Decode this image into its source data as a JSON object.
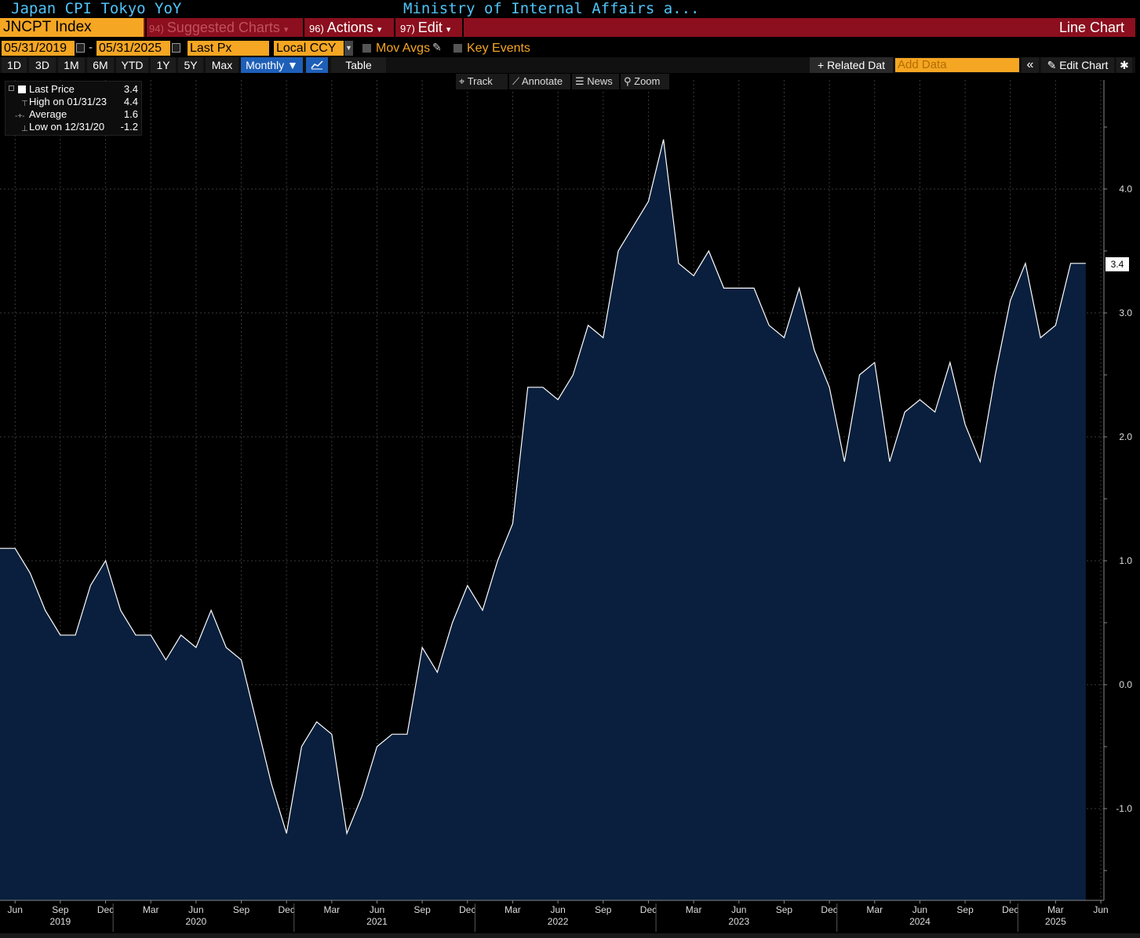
{
  "header": {
    "title_left": "Japan CPI Tokyo YoY",
    "title_right": "Ministry of Internal Affairs a..."
  },
  "command_bar": {
    "ticker": "JNCPT Index",
    "suggested_num": "94)",
    "suggested_label": "Suggested Charts",
    "actions_num": "96)",
    "actions_label": "Actions",
    "edit_num": "97)",
    "edit_label": "Edit",
    "chart_type": "Line Chart",
    "dropdown_glyph": "▾"
  },
  "range_bar": {
    "start_date": "05/31/2019",
    "end_date": "05/31/2025",
    "date_separator": "-",
    "field": "Last Px",
    "currency": "Local CCY",
    "mov_avgs": "Mov Avgs",
    "key_events": "Key Events"
  },
  "period_bar": {
    "buttons": [
      "1D",
      "3D",
      "1M",
      "6M",
      "YTD",
      "1Y",
      "5Y",
      "Max"
    ],
    "frequency": "Monthly ▼",
    "table": "Table",
    "related": "+ Related Dat",
    "add_data_placeholder": "Add Data",
    "collapse": "«",
    "edit_chart": "Edit Chart",
    "settings": "✱"
  },
  "tools": {
    "track": "Track",
    "annotate": "Annotate",
    "news": "News",
    "zoom": "Zoom"
  },
  "legend": {
    "last_label": "Last Price",
    "last_value": "3.4",
    "high_label": "High on 01/31/23",
    "high_value": "4.4",
    "avg_label": "Average",
    "avg_value": "1.6",
    "low_label": "Low on 12/31/20",
    "low_value": "-1.2"
  },
  "last_badge": "3.4",
  "colors": {
    "accent_orange": "#f5a623",
    "bar_red": "#8b0f1e",
    "title_blue": "#4fc3f7",
    "fill": "#0a1f3d"
  },
  "chart_data": {
    "type": "area",
    "x": [
      "2019-05",
      "2019-06",
      "2019-07",
      "2019-08",
      "2019-09",
      "2019-10",
      "2019-11",
      "2019-12",
      "2020-01",
      "2020-02",
      "2020-03",
      "2020-04",
      "2020-05",
      "2020-06",
      "2020-07",
      "2020-08",
      "2020-09",
      "2020-10",
      "2020-11",
      "2020-12",
      "2021-01",
      "2021-02",
      "2021-03",
      "2021-04",
      "2021-05",
      "2021-06",
      "2021-07",
      "2021-08",
      "2021-09",
      "2021-10",
      "2021-11",
      "2021-12",
      "2022-01",
      "2022-02",
      "2022-03",
      "2022-04",
      "2022-05",
      "2022-06",
      "2022-07",
      "2022-08",
      "2022-09",
      "2022-10",
      "2022-11",
      "2022-12",
      "2023-01",
      "2023-02",
      "2023-03",
      "2023-04",
      "2023-05",
      "2023-06",
      "2023-07",
      "2023-08",
      "2023-09",
      "2023-10",
      "2023-11",
      "2023-12",
      "2024-01",
      "2024-02",
      "2024-03",
      "2024-04",
      "2024-05",
      "2024-06",
      "2024-07",
      "2024-08",
      "2024-09",
      "2024-10",
      "2024-11",
      "2024-12",
      "2025-01",
      "2025-02",
      "2025-03",
      "2025-04",
      "2025-05"
    ],
    "values": [
      1.1,
      1.1,
      0.9,
      0.6,
      0.4,
      0.4,
      0.8,
      1.0,
      0.6,
      0.4,
      0.4,
      0.2,
      0.4,
      0.3,
      0.6,
      0.3,
      0.2,
      -0.3,
      -0.8,
      -1.2,
      -0.5,
      -0.3,
      -0.4,
      -1.2,
      -0.9,
      -0.5,
      -0.4,
      -0.4,
      0.3,
      0.1,
      0.5,
      0.8,
      0.6,
      1.0,
      1.3,
      2.4,
      2.4,
      2.3,
      2.5,
      2.9,
      2.8,
      3.5,
      3.7,
      3.9,
      4.4,
      3.4,
      3.3,
      3.5,
      3.2,
      3.2,
      3.2,
      2.9,
      2.8,
      3.2,
      2.7,
      2.4,
      1.8,
      2.5,
      2.6,
      1.8,
      2.2,
      2.3,
      2.2,
      2.6,
      2.1,
      1.8,
      2.5,
      3.1,
      3.4,
      2.8,
      2.9,
      3.4,
      3.4
    ],
    "y_ticks": [
      "4.0",
      "3.0",
      "2.0",
      "1.0",
      "0.0",
      "-1.0"
    ],
    "ylim": [
      -1.75,
      4.95
    ],
    "x_month_labels": [
      {
        "month": "Jun",
        "date": "2019-06"
      },
      {
        "month": "Sep",
        "date": "2019-09"
      },
      {
        "month": "Dec",
        "date": "2019-12"
      },
      {
        "month": "Mar",
        "date": "2020-03"
      },
      {
        "month": "Jun",
        "date": "2020-06"
      },
      {
        "month": "Sep",
        "date": "2020-09"
      },
      {
        "month": "Dec",
        "date": "2020-12"
      },
      {
        "month": "Mar",
        "date": "2021-03"
      },
      {
        "month": "Jun",
        "date": "2021-06"
      },
      {
        "month": "Sep",
        "date": "2021-09"
      },
      {
        "month": "Dec",
        "date": "2021-12"
      },
      {
        "month": "Mar",
        "date": "2022-03"
      },
      {
        "month": "Jun",
        "date": "2022-06"
      },
      {
        "month": "Sep",
        "date": "2022-09"
      },
      {
        "month": "Dec",
        "date": "2022-12"
      },
      {
        "month": "Mar",
        "date": "2023-03"
      },
      {
        "month": "Jun",
        "date": "2023-06"
      },
      {
        "month": "Sep",
        "date": "2023-09"
      },
      {
        "month": "Dec",
        "date": "2023-12"
      },
      {
        "month": "Mar",
        "date": "2024-03"
      },
      {
        "month": "Jun",
        "date": "2024-06"
      },
      {
        "month": "Sep",
        "date": "2024-09"
      },
      {
        "month": "Dec",
        "date": "2024-12"
      },
      {
        "month": "Mar",
        "date": "2025-03"
      },
      {
        "month": "Jun",
        "date": "2025-06"
      }
    ],
    "x_year_labels": [
      {
        "year": "2019",
        "date": "2019-09"
      },
      {
        "year": "2020",
        "date": "2020-06"
      },
      {
        "year": "2021",
        "date": "2021-06"
      },
      {
        "year": "2022",
        "date": "2022-06"
      },
      {
        "year": "2023",
        "date": "2023-06"
      },
      {
        "year": "2024",
        "date": "2024-06"
      },
      {
        "year": "2025",
        "date": "2025-03"
      }
    ],
    "grid": true,
    "legend_position": "top-left"
  }
}
